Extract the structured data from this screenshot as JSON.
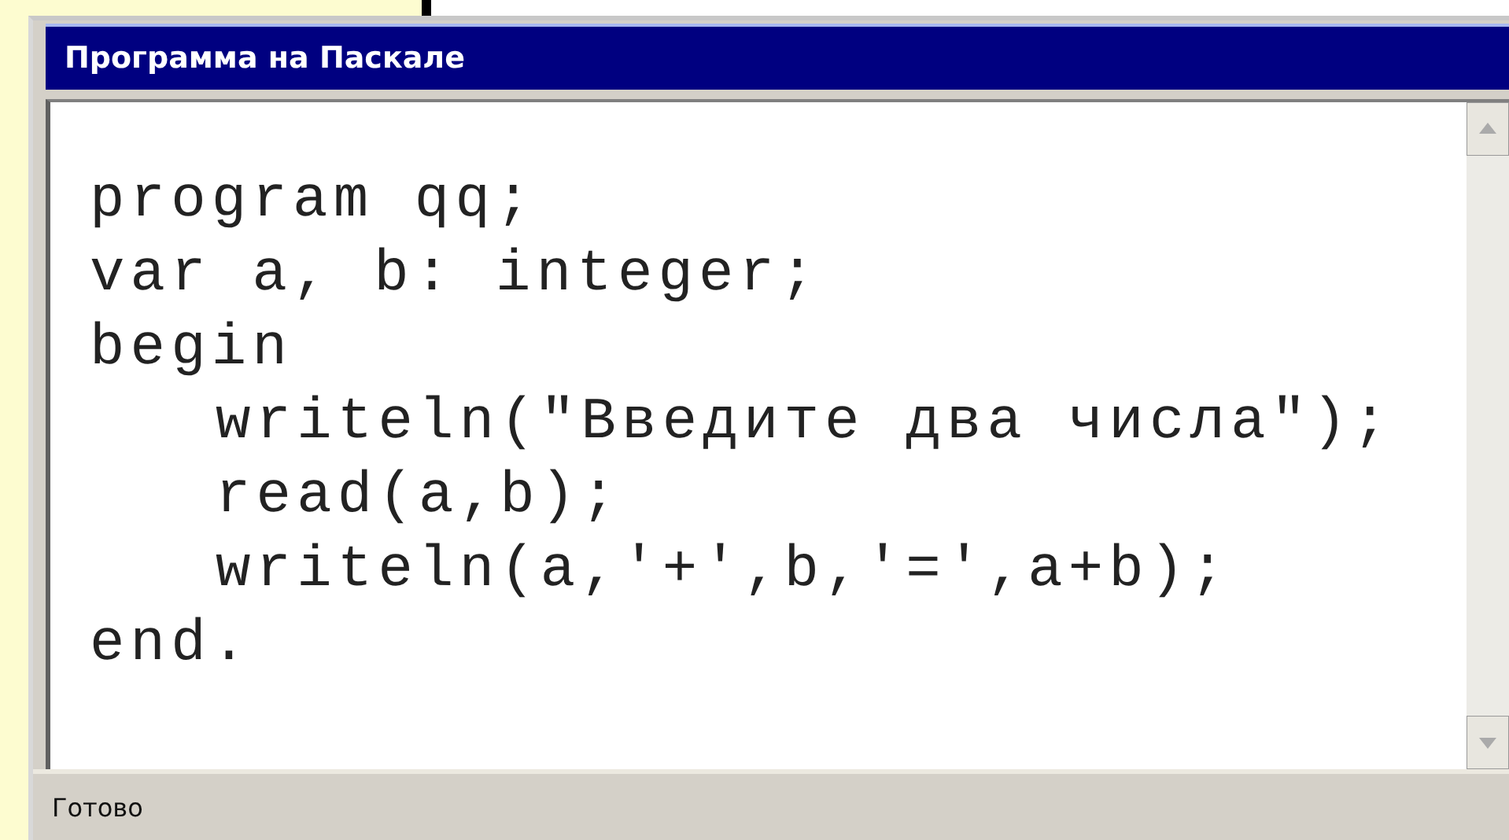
{
  "window": {
    "title": "Программа на Паскале"
  },
  "code": [
    {
      "text": "program qq;"
    },
    {
      "text": "var a, b: integer;"
    },
    {
      "text": "begin",
      "children": [
        {
          "text": "writeln(\"Введите два числа\");"
        },
        {
          "text": "read(a,b);"
        },
        {
          "text": "writeln(a,'+',b,'=',a+b);"
        }
      ]
    },
    {
      "text": "end."
    }
  ],
  "status_bar": {
    "text": "Готово"
  }
}
